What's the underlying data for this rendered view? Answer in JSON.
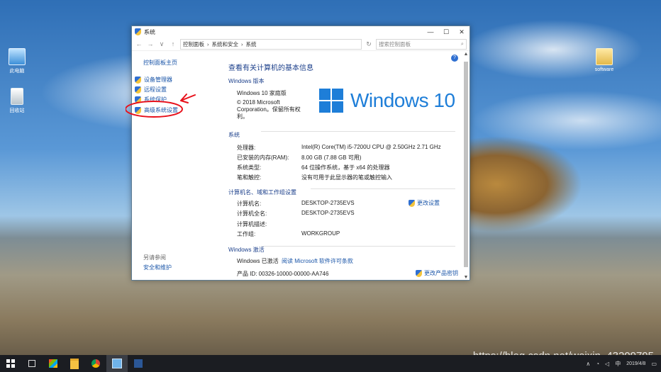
{
  "desktop": {
    "icons": [
      {
        "label": "此电脑"
      },
      {
        "label": "回收站"
      },
      {
        "label": "software"
      }
    ],
    "watermark": "https://blog.csdn.net/weixin_43209795"
  },
  "window": {
    "title": "系统",
    "controls": {
      "minimize": "—",
      "maximize": "☐",
      "close": "✕"
    },
    "address": {
      "nav": {
        "back": "←",
        "forward": "→",
        "recent": "∨",
        "up": "↑"
      },
      "breadcrumbs": [
        "控制面板",
        "系统和安全",
        "系统"
      ],
      "refresh": "↻",
      "search_placeholder": "搜索控制面板",
      "search_icon": "search-icon"
    },
    "sidebar": {
      "home": "控制面板主页",
      "links": [
        "设备管理器",
        "远程设置",
        "系统保护",
        "高级系统设置"
      ],
      "see_also": "另请参阅",
      "security_maintenance": "安全和维护"
    },
    "content": {
      "heading": "查看有关计算机的基本信息",
      "edition": {
        "section": "Windows 版本",
        "name": "Windows 10 家庭版",
        "copyright": "© 2018 Microsoft Corporation。保留所有权利。",
        "logo_text": "Windows 10"
      },
      "system": {
        "section": "系统",
        "rows": [
          {
            "label": "处理器:",
            "value": "Intel(R) Core(TM) i5-7200U CPU @ 2.50GHz   2.71 GHz"
          },
          {
            "label": "已安装的内存(RAM):",
            "value": "8.00 GB (7.88 GB 可用)"
          },
          {
            "label": "系统类型:",
            "value": "64 位操作系统，基于 x64 的处理器"
          },
          {
            "label": "笔和触控:",
            "value": "没有可用于此显示器的笔或触控输入"
          }
        ]
      },
      "computer": {
        "section": "计算机名、域和工作组设置",
        "rows": [
          {
            "label": "计算机名:",
            "value": "DESKTOP-2735EVS"
          },
          {
            "label": "计算机全名:",
            "value": "DESKTOP-2735EVS"
          },
          {
            "label": "计算机描述:",
            "value": ""
          },
          {
            "label": "工作组:",
            "value": "WORKGROUP"
          }
        ],
        "change_settings": "更改设置"
      },
      "activation": {
        "section": "Windows 激活",
        "status": "Windows 已激活",
        "license_link": "阅读 Microsoft 软件许可条款",
        "product_id": "产品 ID: 00326-10000-00000-AA746",
        "change_key": "更改产品密钥"
      },
      "help": "?"
    }
  },
  "taskbar": {
    "date": "2019/4/8",
    "tray_chevron": "∧",
    "ime": "中"
  }
}
